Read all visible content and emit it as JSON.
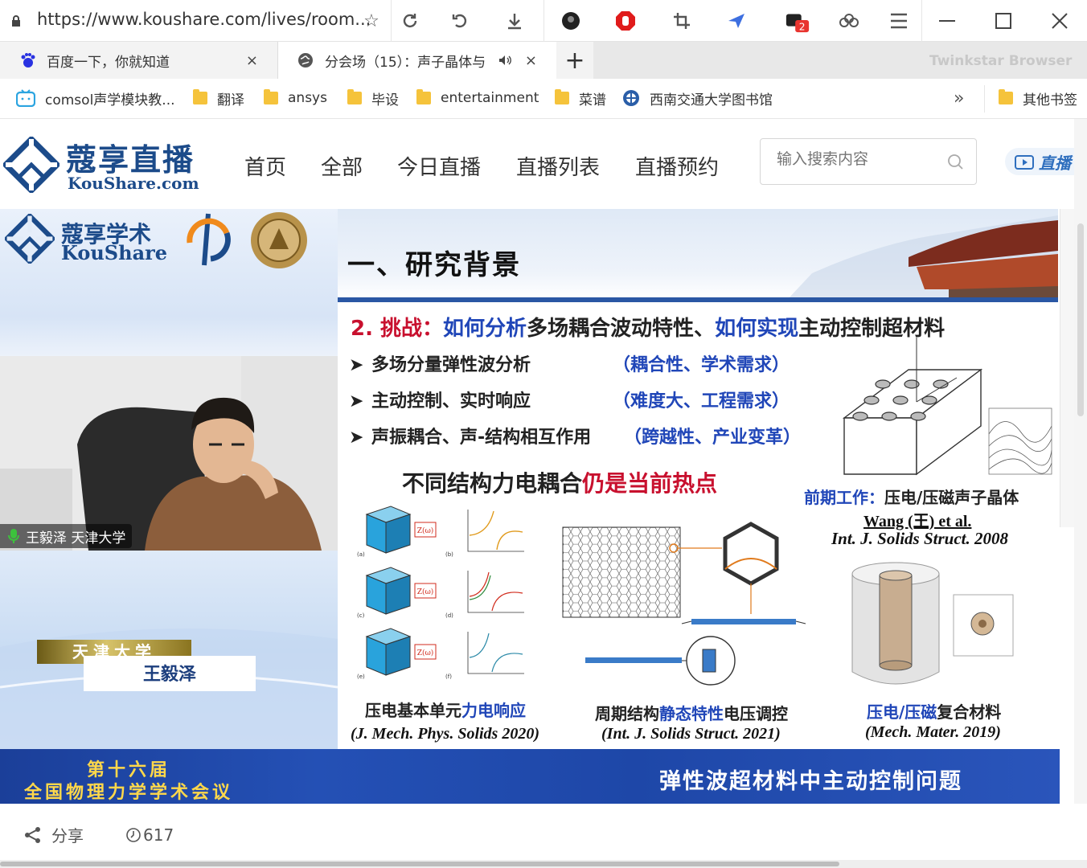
{
  "browser": {
    "url": "https://www.koushare.com/lives/room...",
    "brand": "Twinkstar Browser",
    "ext_badge": "2",
    "tabs": [
      {
        "title": "百度一下，你就知道",
        "close": "×"
      },
      {
        "title": "分会场（15）：声子晶体与",
        "close": "×"
      }
    ],
    "new_tab": "+",
    "bookmarks": [
      "comsol声学模块教...",
      "翻译",
      "ansys",
      "毕设",
      "entertainment",
      "菜谱",
      "西南交通大学图书馆"
    ],
    "bookmarks_more": "»",
    "other_bookmarks": "其他书签"
  },
  "site": {
    "logo_cn": "蔻享直播",
    "logo_en": "KouShare.com",
    "nav": [
      "首页",
      "全部",
      "今日直播",
      "直播列表",
      "直播预约"
    ],
    "search_placeholder": "输入搜索内容",
    "live_button": "直播"
  },
  "video": {
    "kous_logo_cn": "蔻享学术",
    "kous_logo_en": "KouShare",
    "speaker_tag": "王毅泽 天津大学",
    "name_university": "天津大学",
    "name_person": "王毅泽",
    "conference_line1": "第十六届",
    "conference_line2": "全国物理力学学术会议",
    "topic": "弹性波超材料中主动控制问题"
  },
  "slide": {
    "title": "一、研究背景",
    "challenge_num": "2. 挑战：",
    "challenge_p1": "如何分析",
    "challenge_p2": "多场耦合波动特性、",
    "challenge_p3": "如何实现",
    "challenge_p4": "主动控制超材料",
    "bullets": [
      {
        "text": "多场分量弹性波分析",
        "note": "（耦合性、学术需求）"
      },
      {
        "text": "主动控制、实时响应",
        "note": "（难度大、工程需求）"
      },
      {
        "text": "声振耦合、声-结构相互作用",
        "note": "（跨越性、产业变革）"
      }
    ],
    "hot_p1": "不同结构力电耦合",
    "hot_p2": "仍是当前热点",
    "prior_label": "前期工作：",
    "prior_text": "压电/压磁声子晶体",
    "prior_author": "Wang (王) et al.",
    "prior_journal": "Int. J. Solids Struct. 2008",
    "fig_caption1_a": "压电基本单元",
    "fig_caption1_b": "力电响应",
    "fig_cite1": "(J. Mech. Phys. Solids 2020)",
    "fig_caption2_a": "周期结构",
    "fig_caption2_b": "静态特性",
    "fig_caption2_c": "电压调控",
    "fig_cite2": "(Int. J. Solids Struct. 2021)",
    "fig_caption3_a": "压电/压磁",
    "fig_caption3_b": "复合材料",
    "fig_cite3": "(Mech. Mater.  2019)",
    "fig_letters": [
      "(a)",
      "(b)",
      "(c)",
      "(d)",
      "(e)",
      "(f)"
    ],
    "z_label": "Z(ω)"
  },
  "footer": {
    "share": "分享",
    "views": "617"
  },
  "colors": {
    "brand_blue": "#1c4b8a",
    "slide_red": "#c8102e",
    "slide_blue": "#2046b8",
    "conf_yellow": "#ffd84a",
    "conf_bar": "#2450b5"
  }
}
